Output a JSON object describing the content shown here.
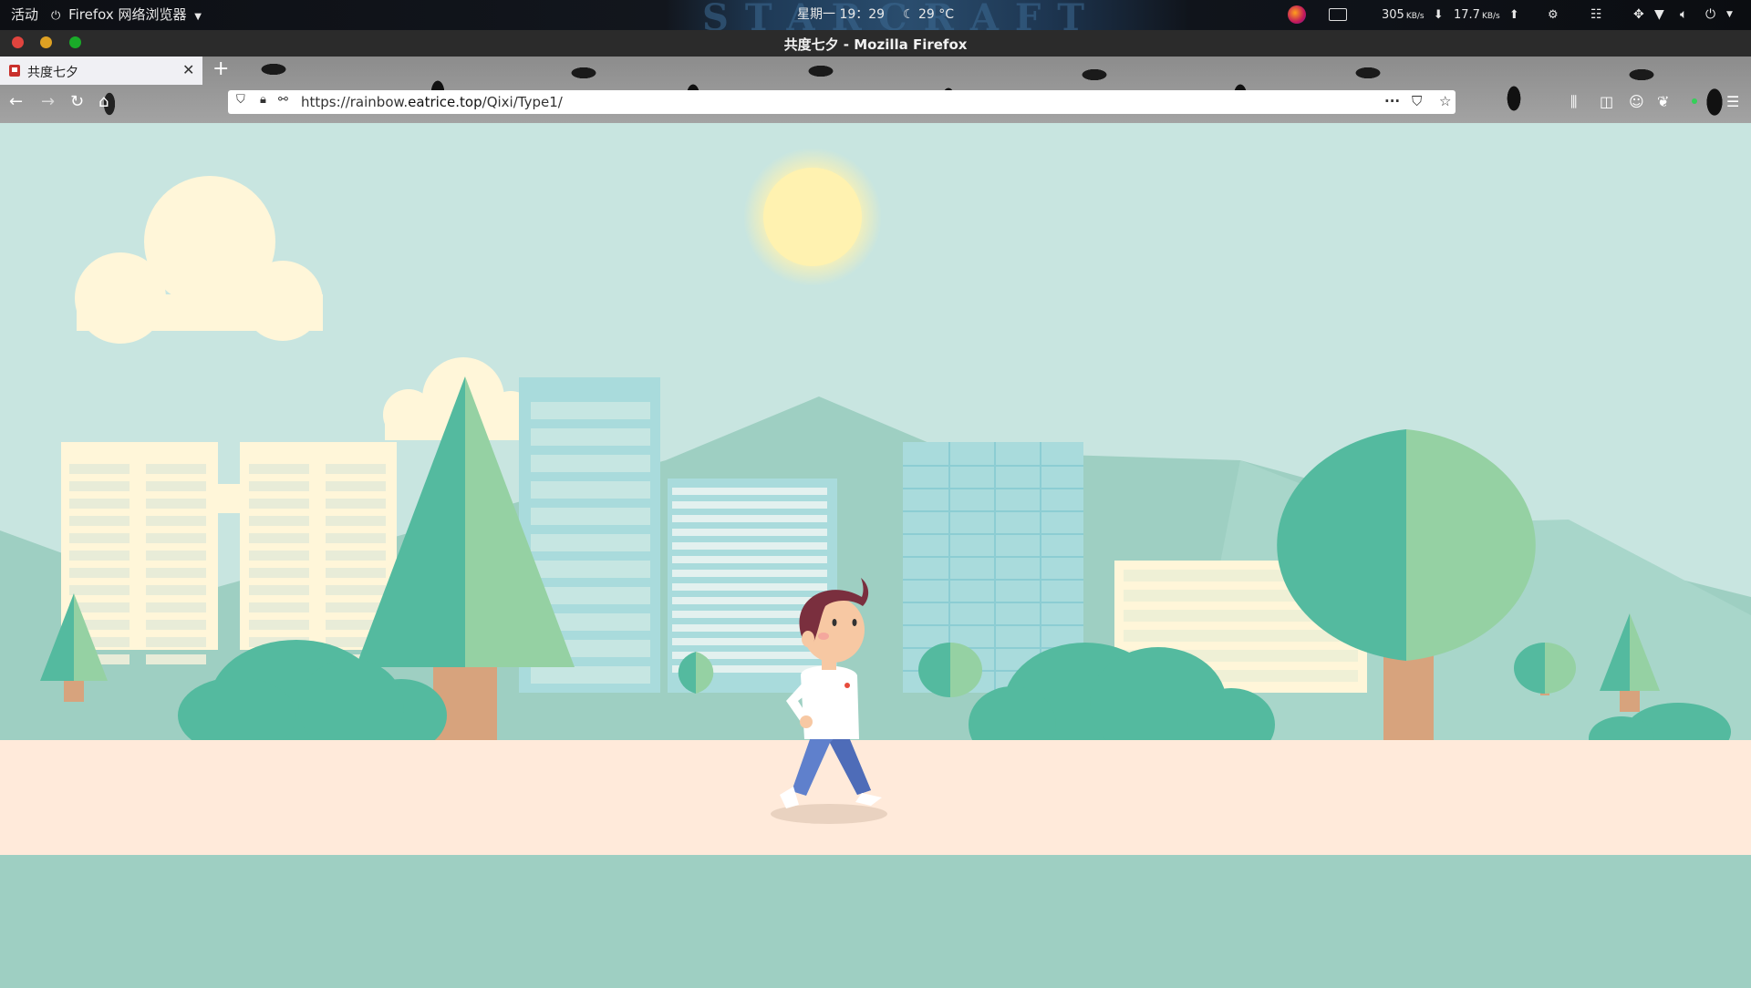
{
  "topbar": {
    "activities": "活动",
    "app_menu": "Firefox 网络浏览器",
    "clock": "星期一 19：29",
    "weather": "29 °C",
    "net_down": "305",
    "net_down_unit": "KB/s",
    "net_up": "17.7",
    "net_up_unit": "KB/s"
  },
  "window": {
    "title": "共度七夕 - Mozilla Firefox"
  },
  "tabs": [
    {
      "title": "共度七夕",
      "active": true
    }
  ],
  "toolbar": {
    "url_prefix": "https://rainbow.",
    "url_domain": "eatrice.top",
    "url_path": "/Qixi/Type1/"
  },
  "colors": {
    "sky": "#c8e5e0",
    "ground": "#ffeada",
    "teal_dark": "#54ba9f",
    "teal_light": "#95d1a3",
    "sun": "#fff2b0",
    "trunk": "#d7a37d"
  }
}
